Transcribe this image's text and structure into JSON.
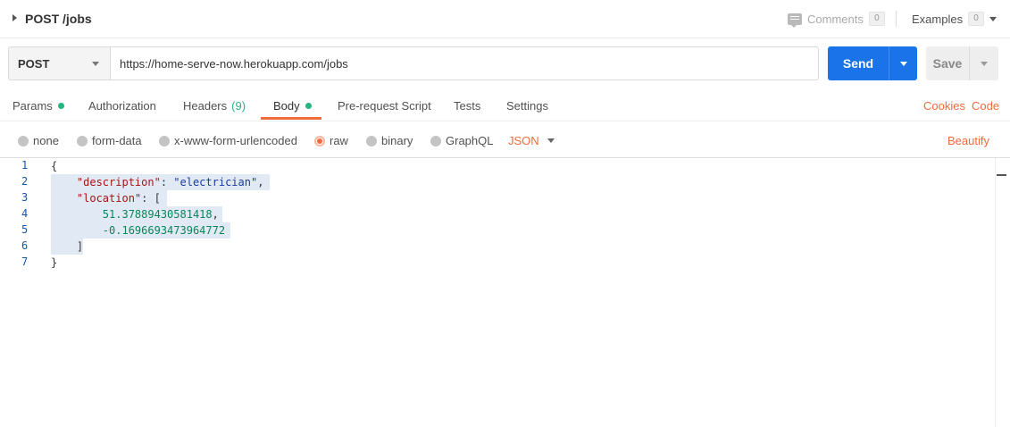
{
  "titlebar": {
    "title": "POST /jobs",
    "comments_label": "Comments",
    "comments_count": "0",
    "examples_label": "Examples",
    "examples_count": "0"
  },
  "request": {
    "method": "POST",
    "url": "https://home-serve-now.herokuapp.com/jobs",
    "send_label": "Send",
    "save_label": "Save"
  },
  "tabs": {
    "params": "Params",
    "authorization": "Authorization",
    "headers": "Headers",
    "headers_count": "(9)",
    "body": "Body",
    "prerequest": "Pre-request Script",
    "tests": "Tests",
    "settings": "Settings",
    "cookies": "Cookies",
    "code": "Code"
  },
  "body_types": {
    "none": "none",
    "form_data": "form-data",
    "urlencoded": "x-www-form-urlencoded",
    "raw": "raw",
    "binary": "binary",
    "graphql": "GraphQL",
    "format": "JSON",
    "beautify": "Beautify"
  },
  "editor": {
    "line_numbers": [
      "1",
      "2",
      "3",
      "4",
      "5",
      "6",
      "7"
    ],
    "tokens": {
      "open_brace": "{",
      "description_key": "\"description\"",
      "description_colon": ": ",
      "description_value": "\"electrician\"",
      "description_comma": ",",
      "location_key": "\"location\"",
      "location_bracket": ": [",
      "lat": "51.37889430581418",
      "lat_comma": ",",
      "lng": "-0.1696693473964772",
      "close_bracket": "]",
      "close_brace": "}"
    }
  },
  "colors": {
    "accent": "#f26b3a",
    "send": "#1a73e8",
    "status_green": "#26b47f"
  }
}
